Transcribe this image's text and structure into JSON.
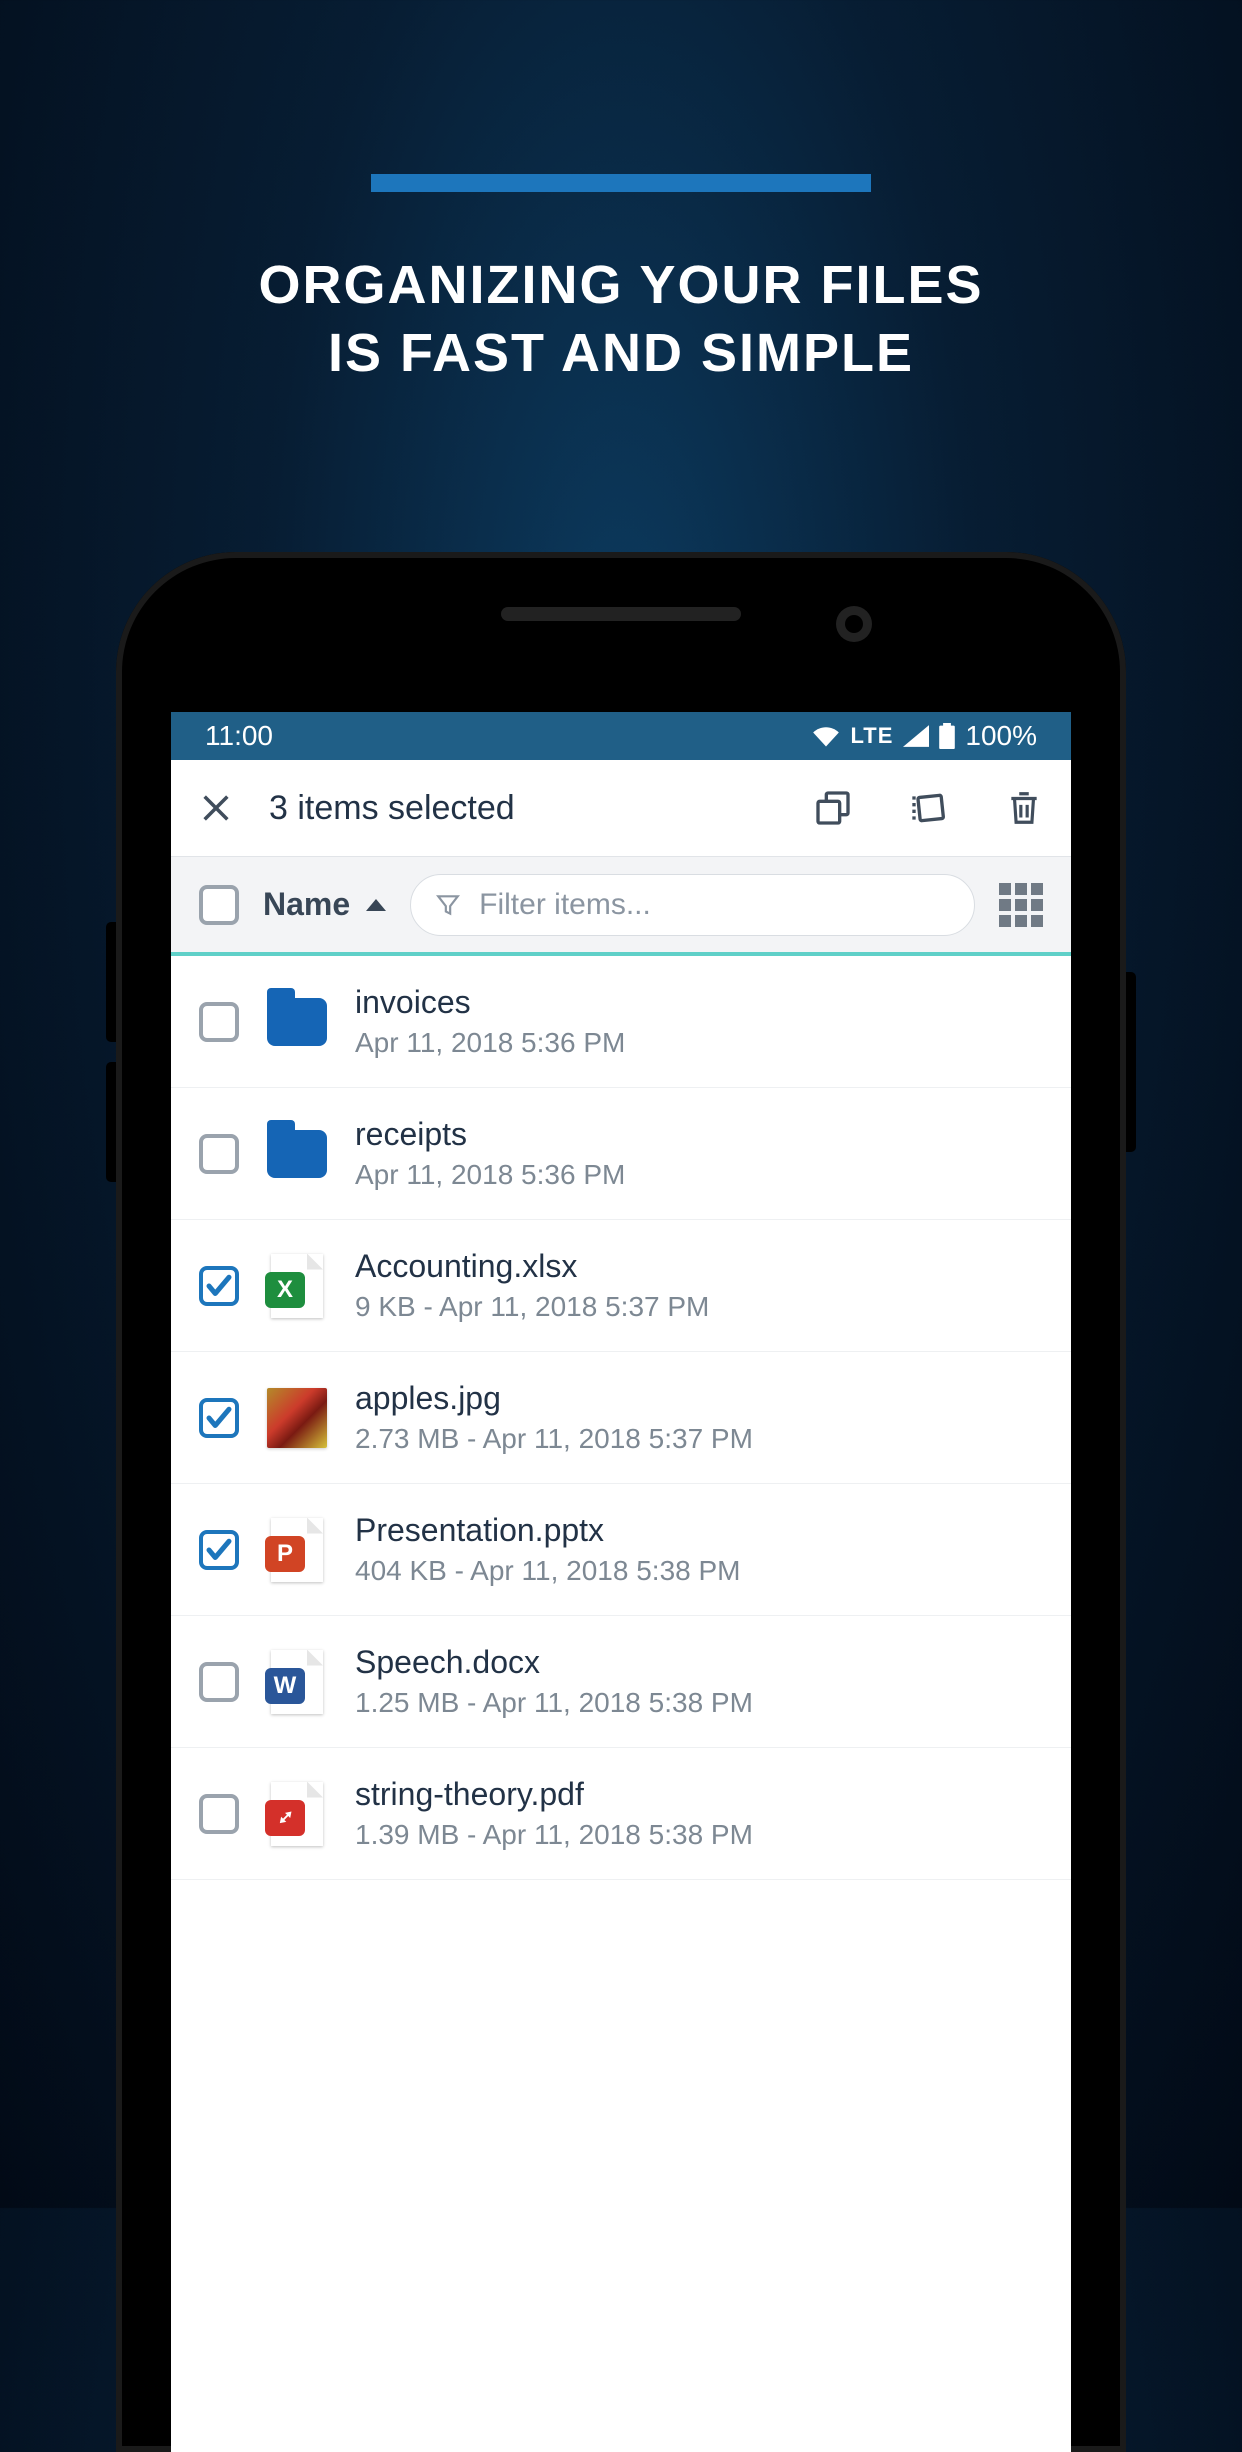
{
  "promo": {
    "line1": "ORGANIZING YOUR FILES",
    "line2": "IS FAST AND SIMPLE"
  },
  "statusbar": {
    "time": "11:00",
    "network": "LTE",
    "battery": "100%"
  },
  "appbar": {
    "title": "3 items selected"
  },
  "filterbar": {
    "sort_label": "Name",
    "filter_placeholder": "Filter items..."
  },
  "files": [
    {
      "name": "invoices",
      "meta": "Apr 11, 2018 5:36 PM",
      "type": "folder",
      "selected": false
    },
    {
      "name": "receipts",
      "meta": "Apr 11, 2018 5:36 PM",
      "type": "folder",
      "selected": false
    },
    {
      "name": "Accounting.xlsx",
      "meta": "9 KB - Apr 11, 2018 5:37 PM",
      "type": "xlsx",
      "selected": true
    },
    {
      "name": "apples.jpg",
      "meta": "2.73 MB - Apr 11, 2018 5:37 PM",
      "type": "image",
      "selected": true
    },
    {
      "name": "Presentation.pptx",
      "meta": "404 KB - Apr 11, 2018 5:38 PM",
      "type": "pptx",
      "selected": true
    },
    {
      "name": "Speech.docx",
      "meta": "1.25 MB - Apr 11, 2018 5:38 PM",
      "type": "docx",
      "selected": false
    },
    {
      "name": "string-theory.pdf",
      "meta": "1.39 MB - Apr 11, 2018 5:38 PM",
      "type": "pdf",
      "selected": false
    }
  ]
}
